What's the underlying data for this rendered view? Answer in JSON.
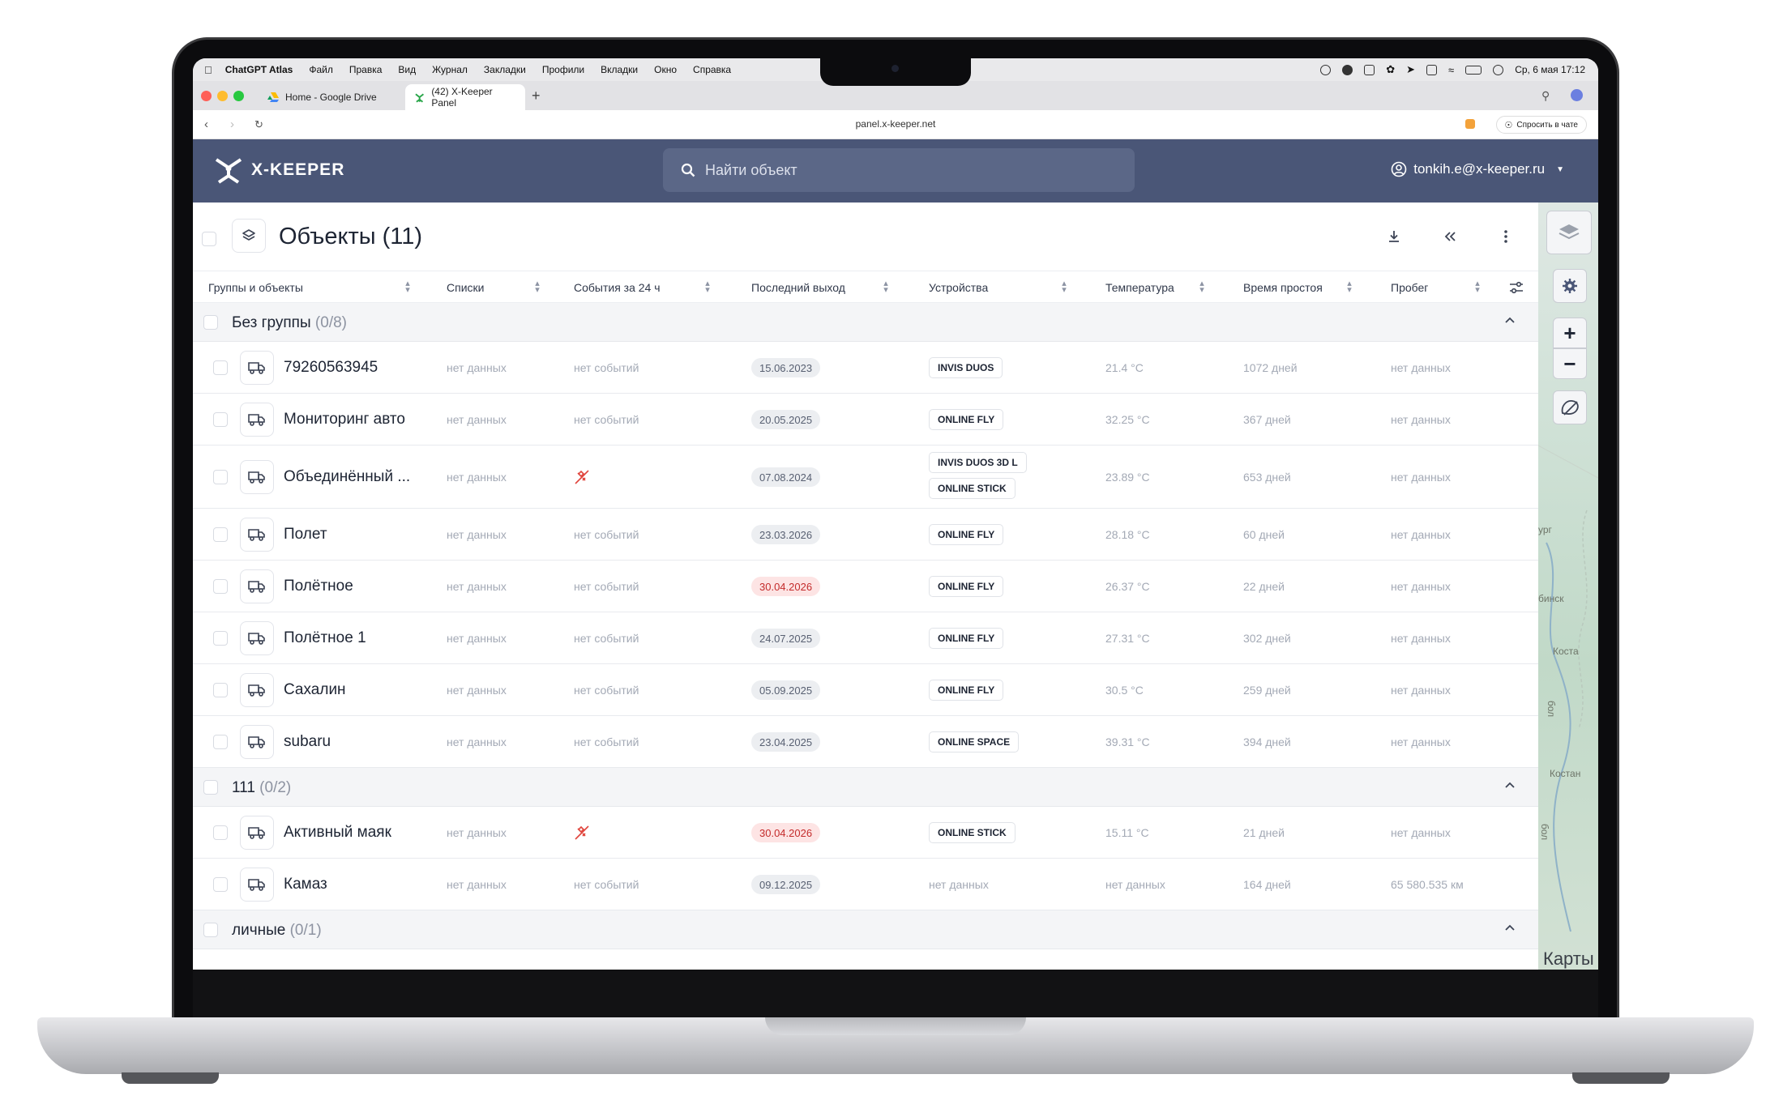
{
  "menubar": {
    "app": "ChatGPT Atlas",
    "items": [
      "Файл",
      "Правка",
      "Вид",
      "Журнал",
      "Закладки",
      "Профили",
      "Вкладки",
      "Окно",
      "Справка"
    ],
    "datetime": "Ср, 6 мая  17:12"
  },
  "browser": {
    "tabs": [
      {
        "label": "Home - Google Drive"
      },
      {
        "label": "(42) X-Keeper Panel"
      }
    ],
    "url": "panel.x-keeper.net",
    "ask_label": "Спросить в чате"
  },
  "app": {
    "logo": "X-KEEPER",
    "search_placeholder": "Найти объект",
    "user_email": "tonkih.e@x-keeper.ru",
    "title": "Объекты (11)"
  },
  "columns": [
    "Группы и объекты",
    "Списки",
    "События за 24 ч",
    "Последний выход",
    "Устройства",
    "Температура",
    "Время простоя",
    "Пробег"
  ],
  "groups": [
    {
      "name": "Без группы",
      "count": "(0/8)",
      "rows": [
        {
          "name": "79260563945",
          "lists": "нет данных",
          "events": "нет событий",
          "last": "15.06.2023",
          "last_red": false,
          "devices": [
            "INVIS DUOS"
          ],
          "temp": "21.4 °C",
          "idle": "1072 дней",
          "mileage": "нет данных"
        },
        {
          "name": "Мониторинг авто",
          "lists": "нет данных",
          "events": "нет событий",
          "last": "20.05.2025",
          "last_red": false,
          "devices": [
            "ONLINE FLY"
          ],
          "temp": "32.25 °C",
          "idle": "367 дней",
          "mileage": "нет данных"
        },
        {
          "name": "Объединённый ...",
          "lists": "нет данных",
          "events": "",
          "event_icon": "satellite-off-icon",
          "last": "07.08.2024",
          "last_red": false,
          "devices": [
            "INVIS DUOS 3D L",
            "ONLINE STICK"
          ],
          "temp": "23.89 °C",
          "idle": "653 дней",
          "mileage": "нет данных"
        },
        {
          "name": "Полет",
          "lists": "нет данных",
          "events": "нет событий",
          "last": "23.03.2026",
          "last_red": false,
          "devices": [
            "ONLINE FLY"
          ],
          "temp": "28.18 °C",
          "idle": "60 дней",
          "mileage": "нет данных"
        },
        {
          "name": "Полётное",
          "lists": "нет данных",
          "events": "нет событий",
          "last": "30.04.2026",
          "last_red": true,
          "devices": [
            "ONLINE FLY"
          ],
          "temp": "26.37 °C",
          "idle": "22 дней",
          "mileage": "нет данных"
        },
        {
          "name": "Полётное 1",
          "lists": "нет данных",
          "events": "нет событий",
          "last": "24.07.2025",
          "last_red": false,
          "devices": [
            "ONLINE FLY"
          ],
          "temp": "27.31 °C",
          "idle": "302 дней",
          "mileage": "нет данных"
        },
        {
          "name": "Сахалин",
          "lists": "нет данных",
          "events": "нет событий",
          "last": "05.09.2025",
          "last_red": false,
          "devices": [
            "ONLINE FLY"
          ],
          "temp": "30.5 °C",
          "idle": "259 дней",
          "mileage": "нет данных"
        },
        {
          "name": "subaru",
          "lists": "нет данных",
          "events": "нет событий",
          "last": "23.04.2025",
          "last_red": false,
          "devices": [
            "ONLINE SPACE"
          ],
          "temp": "39.31 °C",
          "idle": "394 дней",
          "mileage": "нет данных"
        }
      ]
    },
    {
      "name": "111",
      "count": "(0/2)",
      "rows": [
        {
          "name": "Активный маяк",
          "lists": "нет данных",
          "events": "",
          "event_icon": "satellite-off-icon",
          "last": "30.04.2026",
          "last_red": true,
          "devices": [
            "ONLINE STICK"
          ],
          "temp": "15.11 °C",
          "idle": "21 дней",
          "mileage": "нет данных"
        },
        {
          "name": "Камаз",
          "lists": "нет данных",
          "events": "нет событий",
          "last": "09.12.2025",
          "last_red": false,
          "devices": [],
          "devices_text": "нет данных",
          "temp": "нет данных",
          "idle": "164 дней",
          "mileage": "65 580.535 км"
        }
      ]
    },
    {
      "name": "личные",
      "count": "(0/1)",
      "rows": []
    }
  ],
  "map": {
    "labels": [
      "ург",
      "бинск",
      "Коста",
      "Костан",
      "бол",
      "бол"
    ],
    "credit": "Карты"
  },
  "colors": {
    "header": "#4a5677",
    "search": "#5b6787",
    "red_date": "#c42b2b"
  }
}
